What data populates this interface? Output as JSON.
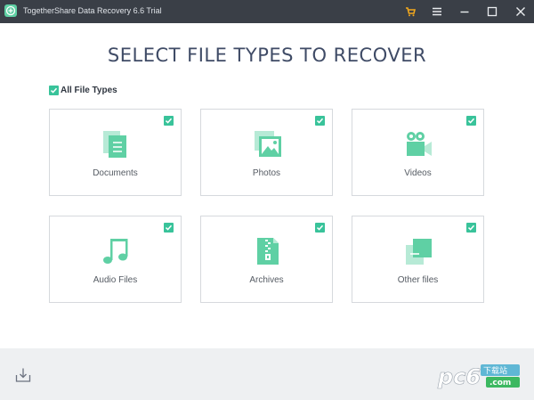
{
  "window": {
    "title": "TogetherShare Data Recovery 6.6 Trial",
    "icons": [
      "app-logo-icon",
      "cart-icon",
      "menu-icon",
      "minimize-icon",
      "maximize-icon",
      "close-icon"
    ]
  },
  "main": {
    "title": "SELECT FILE TYPES TO RECOVER",
    "all_types_label": "All File Types",
    "all_types_checked": true
  },
  "file_types": [
    {
      "label": "Documents",
      "icon": "documents-icon",
      "checked": true
    },
    {
      "label": "Photos",
      "icon": "photo-icon",
      "checked": true
    },
    {
      "label": "Videos",
      "icon": "video-camera-icon",
      "checked": true
    },
    {
      "label": "Audio Files",
      "icon": "music-note-icon",
      "checked": true
    },
    {
      "label": "Archives",
      "icon": "archive-zip-icon",
      "checked": true
    },
    {
      "label": "Other files",
      "icon": "other-files-icon",
      "checked": true
    }
  ],
  "footer": {
    "export_icon": "export-icon",
    "watermark_text": "pc6",
    "watermark_sub": "下载站",
    "watermark_domain": ".com"
  },
  "colors": {
    "accent": "#39c39a",
    "icon_green": "#5fd0a4",
    "titlebar": "#3a3f47",
    "title_text": "#3f4b66",
    "cart": "#f2a81d"
  }
}
